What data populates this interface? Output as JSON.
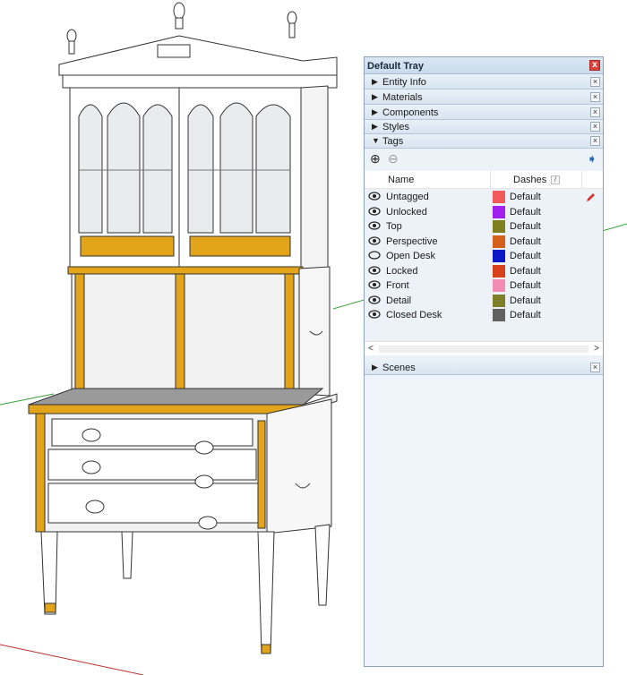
{
  "tray": {
    "title": "Default Tray",
    "close_glyph": "x",
    "panels": [
      {
        "label": "Entity Info",
        "state": "collapsed"
      },
      {
        "label": "Materials",
        "state": "collapsed"
      },
      {
        "label": "Components",
        "state": "collapsed"
      },
      {
        "label": "Styles",
        "state": "collapsed"
      },
      {
        "label": "Tags",
        "state": "expanded"
      },
      {
        "label": "Scenes",
        "state": "collapsed"
      }
    ],
    "tags": {
      "columns": {
        "name": "Name",
        "dashes": "Dashes"
      },
      "toolbar": {
        "add_icon": "plus-circle-icon",
        "remove_icon": "minus-circle-icon",
        "details_icon": "details-arrow-icon"
      },
      "rows": [
        {
          "name": "Untagged",
          "visible": true,
          "color": "#f05a5a",
          "dashes": "Default"
        },
        {
          "name": "Unlocked",
          "visible": true,
          "color": "#a020f0",
          "dashes": "Default"
        },
        {
          "name": "Top",
          "visible": true,
          "color": "#7f7f1f",
          "dashes": "Default"
        },
        {
          "name": "Perspective",
          "visible": true,
          "color": "#d4601c",
          "dashes": "Default"
        },
        {
          "name": "Open Desk",
          "visible": false,
          "color": "#0a18c8",
          "dashes": "Default"
        },
        {
          "name": "Locked",
          "visible": true,
          "color": "#d6401a",
          "dashes": "Default"
        },
        {
          "name": "Front",
          "visible": true,
          "color": "#f08cb4",
          "dashes": "Default"
        },
        {
          "name": "Detail",
          "visible": true,
          "color": "#7f7f2a",
          "dashes": "Default"
        },
        {
          "name": "Closed Desk",
          "visible": true,
          "color": "#606060",
          "dashes": "Default"
        }
      ]
    }
  },
  "colors": {
    "axis_green": "#3aa03a",
    "axis_red": "#c03030",
    "accent_gold": "#e2a41a"
  }
}
